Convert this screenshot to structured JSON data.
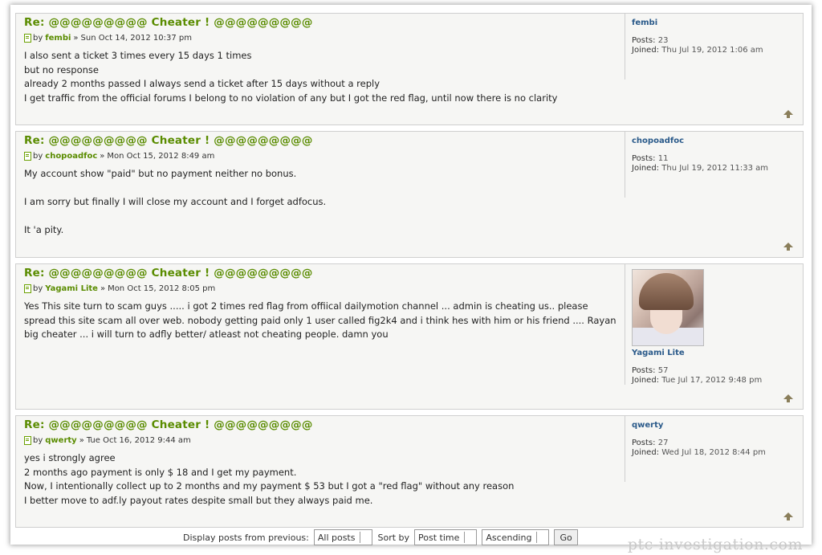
{
  "posts": [
    {
      "title": "Re: @@@@@@@@@ Cheater ! @@@@@@@@@",
      "by": "by",
      "author": "fembi",
      "sep": "»",
      "date": "Sun Oct 14, 2012 10:37 pm",
      "content": [
        "I also sent a ticket 3 times every 15 days 1 times",
        "but no response",
        "already 2 months passed I always send a ticket after 15 days without a reply",
        "I get traffic from the official forums I belong to no violation of any but I got the red flag, until now there is no clarity"
      ],
      "profile": {
        "name": "fembi",
        "posts_label": "Posts:",
        "posts": "23",
        "joined_label": "Joined:",
        "joined": "Thu Jul 19, 2012 1:06 am"
      }
    },
    {
      "title": "Re: @@@@@@@@@ Cheater ! @@@@@@@@@",
      "by": "by",
      "author": "chopoadfoc",
      "sep": "»",
      "date": "Mon Oct 15, 2012 8:49 am",
      "content": [
        "My account show \"paid\" but no payment neither no bonus.",
        "",
        "I am sorry but finally I will close my account and I forget adfocus.",
        "",
        "It 'a pity."
      ],
      "profile": {
        "name": "chopoadfoc",
        "posts_label": "Posts:",
        "posts": "11",
        "joined_label": "Joined:",
        "joined": "Thu Jul 19, 2012 11:33 am"
      }
    },
    {
      "title": "Re: @@@@@@@@@ Cheater ! @@@@@@@@@",
      "by": "by",
      "author": "Yagami Lite",
      "sep": "»",
      "date": "Mon Oct 15, 2012 8:05 pm",
      "content": [
        "Yes This site turn to scam guys ..... i got 2 times red flag from offiical dailymotion channel ... admin is cheating us.. please",
        "spread this site scam all over web. nobody getting paid only 1 user called fig2k4 and i think hes with him or his friend .... Rayan",
        "big cheater ... i will turn to adfly better/ atleast not cheating people. damn you"
      ],
      "profile": {
        "name": "Yagami Lite",
        "posts_label": "Posts:",
        "posts": "57",
        "joined_label": "Joined:",
        "joined": "Tue Jul 17, 2012 9:48 pm"
      }
    },
    {
      "title": "Re: @@@@@@@@@ Cheater ! @@@@@@@@@",
      "by": "by",
      "author": "qwerty",
      "sep": "»",
      "date": "Tue Oct 16, 2012 9:44 am",
      "content": [
        "yes i strongly agree",
        "2 months ago payment is only $ 18 and I get my payment.",
        "Now, I intentionally collect up to 2 months and my payment $ 53 but I got a \"red flag\" without any reason",
        "I better move to adf.ly payout rates despite small but they always paid me."
      ],
      "profile": {
        "name": "qwerty",
        "posts_label": "Posts:",
        "posts": "27",
        "joined_label": "Joined:",
        "joined": "Wed Jul 18, 2012 8:44 pm"
      }
    }
  ],
  "footer": {
    "display_label": "Display posts from previous:",
    "display_value": "All posts",
    "sort_label": "Sort by",
    "sort_value": "Post time",
    "order_value": "Ascending",
    "go_label": "Go"
  },
  "watermark": "ptc-investigation.com"
}
